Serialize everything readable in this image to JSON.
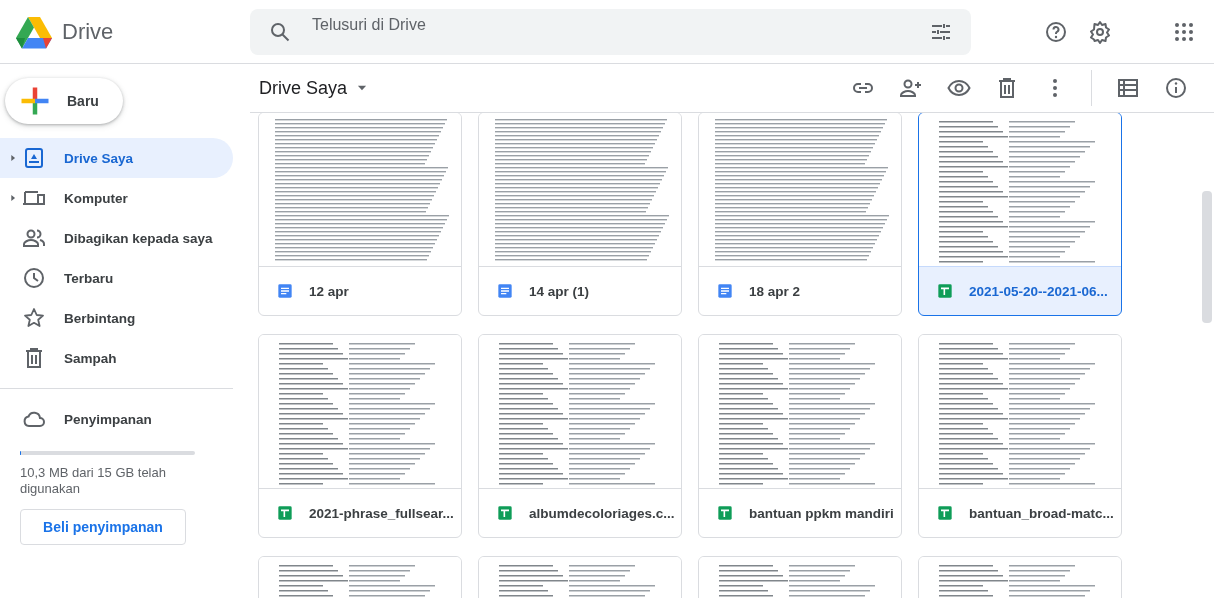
{
  "header": {
    "app_name": "Drive",
    "search": {
      "placeholder": "Telusuri di Drive"
    }
  },
  "sidebar": {
    "new_button": "Baru",
    "items": [
      {
        "label": "Drive Saya",
        "expandable": true,
        "selected": true
      },
      {
        "label": "Komputer",
        "expandable": true,
        "selected": false
      },
      {
        "label": "Dibagikan kepada saya",
        "expandable": false,
        "selected": false
      },
      {
        "label": "Terbaru",
        "expandable": false,
        "selected": false
      },
      {
        "label": "Berbintang",
        "expandable": false,
        "selected": false
      },
      {
        "label": "Sampah",
        "expandable": false,
        "selected": false
      }
    ],
    "storage": {
      "label": "Penyimpanan",
      "level": 0.001,
      "usage": "10,3 MB dari 15 GB telah digunakan",
      "buy_button": "Beli penyimpanan"
    }
  },
  "toolbar": {
    "title": "Drive Saya"
  },
  "files": [
    {
      "name": "12 apr",
      "kind": "doc",
      "selected": false
    },
    {
      "name": "14 apr (1)",
      "kind": "doc",
      "selected": false
    },
    {
      "name": "18 apr 2",
      "kind": "doc",
      "selected": false
    },
    {
      "name": "2021-05-20--2021-06...",
      "kind": "sheet",
      "selected": true
    },
    {
      "name": "2021-phrase_fullsear...",
      "kind": "sheet",
      "selected": false
    },
    {
      "name": "albumdecoloriages.c...",
      "kind": "sheet",
      "selected": false
    },
    {
      "name": "bantuan ppkm mandiri",
      "kind": "sheet",
      "selected": false
    },
    {
      "name": "bantuan_broad-matc...",
      "kind": "sheet",
      "selected": false
    },
    {
      "kind": "sheet",
      "selected": false
    },
    {
      "kind": "sheet",
      "selected": false
    },
    {
      "kind": "sheet",
      "selected": false
    },
    {
      "kind": "sheet",
      "selected": false
    }
  ]
}
